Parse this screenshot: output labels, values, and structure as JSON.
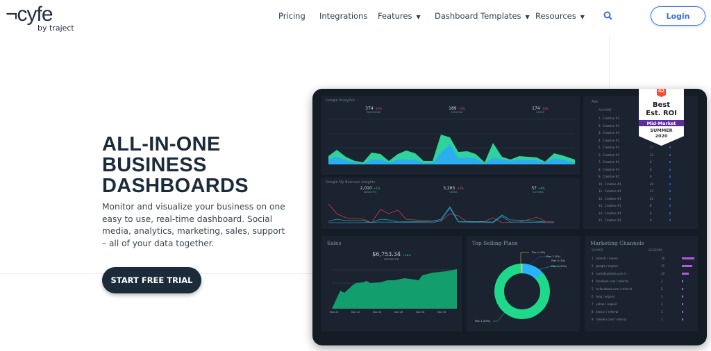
{
  "nav": {
    "logo": "¬cyfe",
    "logo_sub": "by traject",
    "items": [
      {
        "label": "Pricing"
      },
      {
        "label": "Integrations"
      },
      {
        "label": "Features",
        "dropdown": true
      },
      {
        "label": "Dashboard Templates",
        "dropdown": true
      },
      {
        "label": "Resources",
        "dropdown": true
      }
    ],
    "search_icon": "search-icon",
    "login": "Login"
  },
  "hero": {
    "title_lines": [
      "ALL-IN-ONE",
      "BUSINESS",
      "DASHBOARDS"
    ],
    "description": "Monitor and visualize your business on one easy to use, real-time dashboard. Social media, analytics, marketing, sales, support – all of your data together.",
    "cta": "START FREE TRIAL"
  },
  "dashboard": {
    "analytics": {
      "title": "Google Analytics",
      "kpis": [
        {
          "value": "374",
          "change": "-13%",
          "label": "PAGEVIEWS"
        },
        {
          "value": "189",
          "change": "-13%",
          "label": "SESSIONS"
        },
        {
          "value": "174",
          "change": "-13%",
          "label": "USERS"
        }
      ]
    },
    "gmb": {
      "title": "Google My Business Insights",
      "kpis": [
        {
          "value": "2,010",
          "change": "+1%",
          "label": "SEARCHES"
        },
        {
          "value": "3,265",
          "change": "-13%",
          "label": "VIEWS"
        },
        {
          "value": "57",
          "change": "+4%",
          "label": "ACTIONS"
        }
      ]
    },
    "table": {
      "title": "Ads",
      "header": "AD NAME",
      "rows": [
        "Creative #1",
        "Creative #1",
        "Creative #1",
        "Creative #1",
        "Creative #1",
        "Creative #1",
        "Creative #1",
        "Creative #1",
        "Creative #1",
        "Creative #1",
        "Creative #1",
        "Creative #1",
        "Creative #1",
        "Creative #1",
        "Creative #1"
      ],
      "values": [
        "",
        "",
        "",
        "",
        "17",
        "22",
        "6",
        "6",
        "6",
        "30",
        "27",
        "22",
        "8",
        "6",
        "9"
      ]
    },
    "sales": {
      "title": "Sales",
      "value": "$6,753.34",
      "change": "+24%",
      "label": "REVENUE",
      "x_labels": [
        "Nov 20",
        "Nov 22",
        "Nov 24",
        "Nov 26",
        "Nov 28",
        "Nov 30"
      ]
    },
    "plans": {
      "title": "Top Selling Plans",
      "labels": [
        "Plan 1 (83%)",
        "Plan 4 (13%)",
        "Plan 3 (1%)",
        "Plan 2 (2%)",
        "Plan / (4%)"
      ],
      "colors": [
        "#1ed98a",
        "#26b4ff",
        "#3b6ee8",
        "#e8d84a"
      ]
    },
    "marketing": {
      "title": "Marketing Channels",
      "headers": [
        "SOURCE",
        "SESSIONS"
      ],
      "rows": [
        {
          "source": "(direct) / (none)",
          "sessions": "16"
        },
        {
          "source": "google / organic",
          "sessions": "15"
        },
        {
          "source": "sortedsystems.com / r",
          "sessions": "10"
        },
        {
          "source": "facebook.com / referral",
          "sessions": "2"
        },
        {
          "source": "m.facebook.com / referral",
          "sessions": "2"
        },
        {
          "source": "bing / organic",
          "sessions": "2"
        },
        {
          "source": "yahoo / organic",
          "sessions": "2"
        },
        {
          "source": "lnkd.in / referral",
          "sessions": "1"
        },
        {
          "source": "linkedin.com / referral",
          "sessions": "1"
        }
      ]
    },
    "badge": {
      "brand": "G2",
      "line1": "Best",
      "line2": "Est. ROI",
      "segment": "Mid-Market",
      "season": "SUMMER",
      "year": "2020"
    }
  },
  "colors": {
    "accent": "#3b6ee8",
    "dark": "#1c2b3a",
    "green": "#1ed98a",
    "blue": "#26b4ff",
    "purple": "#5b2f9e"
  }
}
